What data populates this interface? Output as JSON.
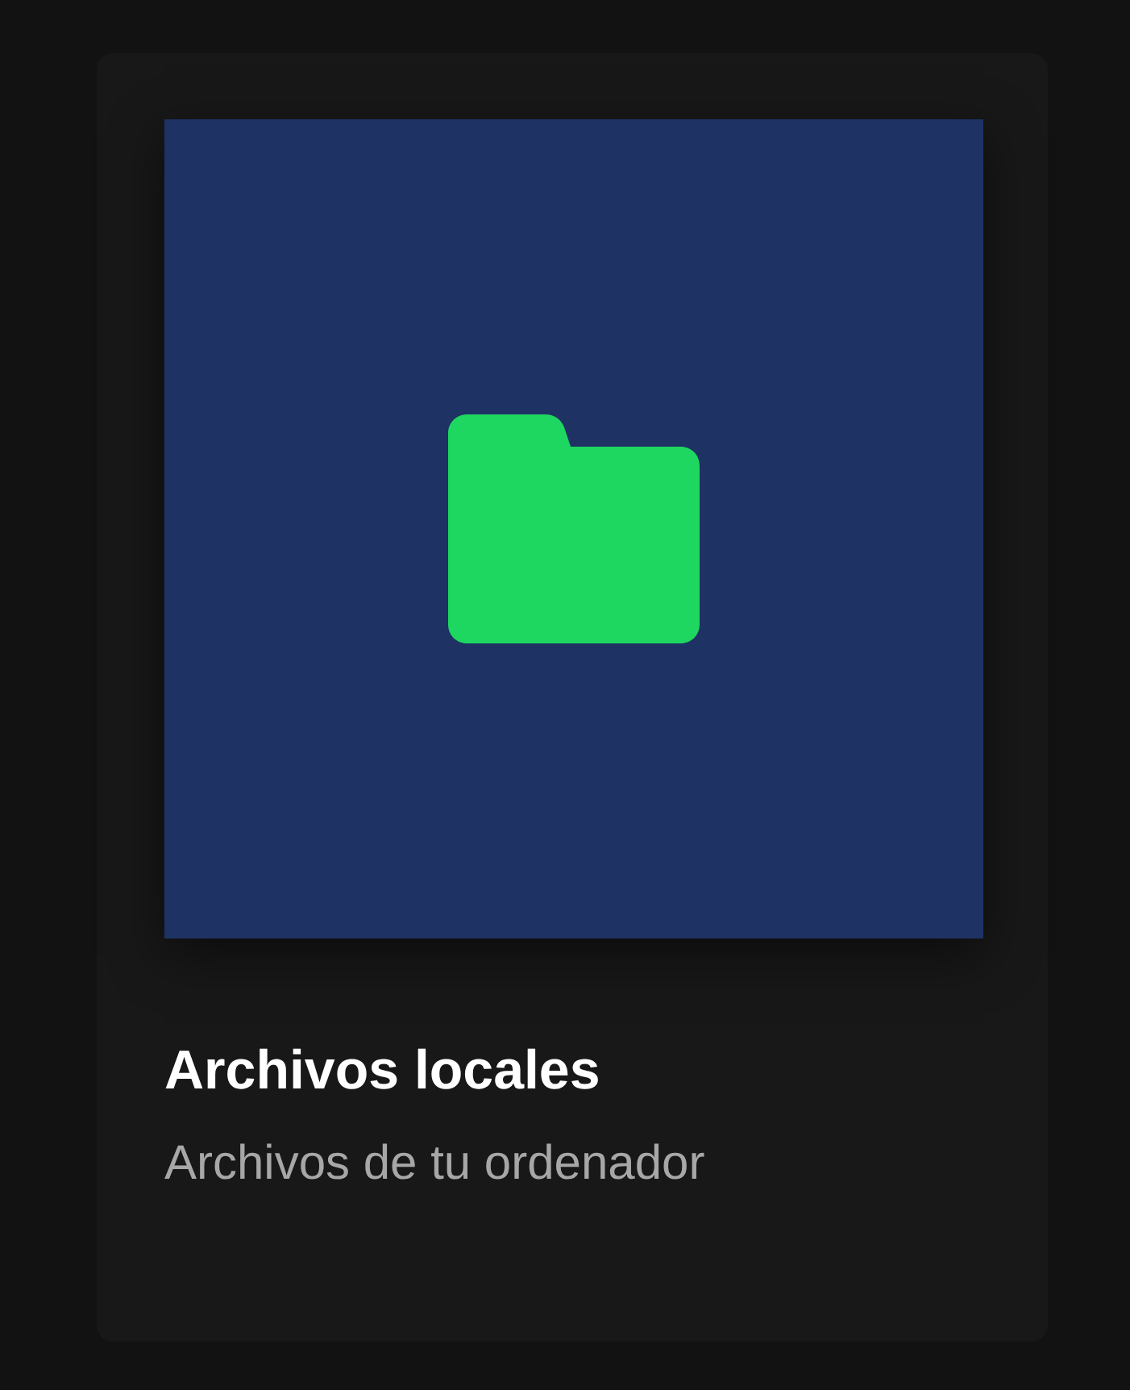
{
  "card": {
    "title": "Archivos locales",
    "subtitle": "Archivos de tu ordenador"
  }
}
